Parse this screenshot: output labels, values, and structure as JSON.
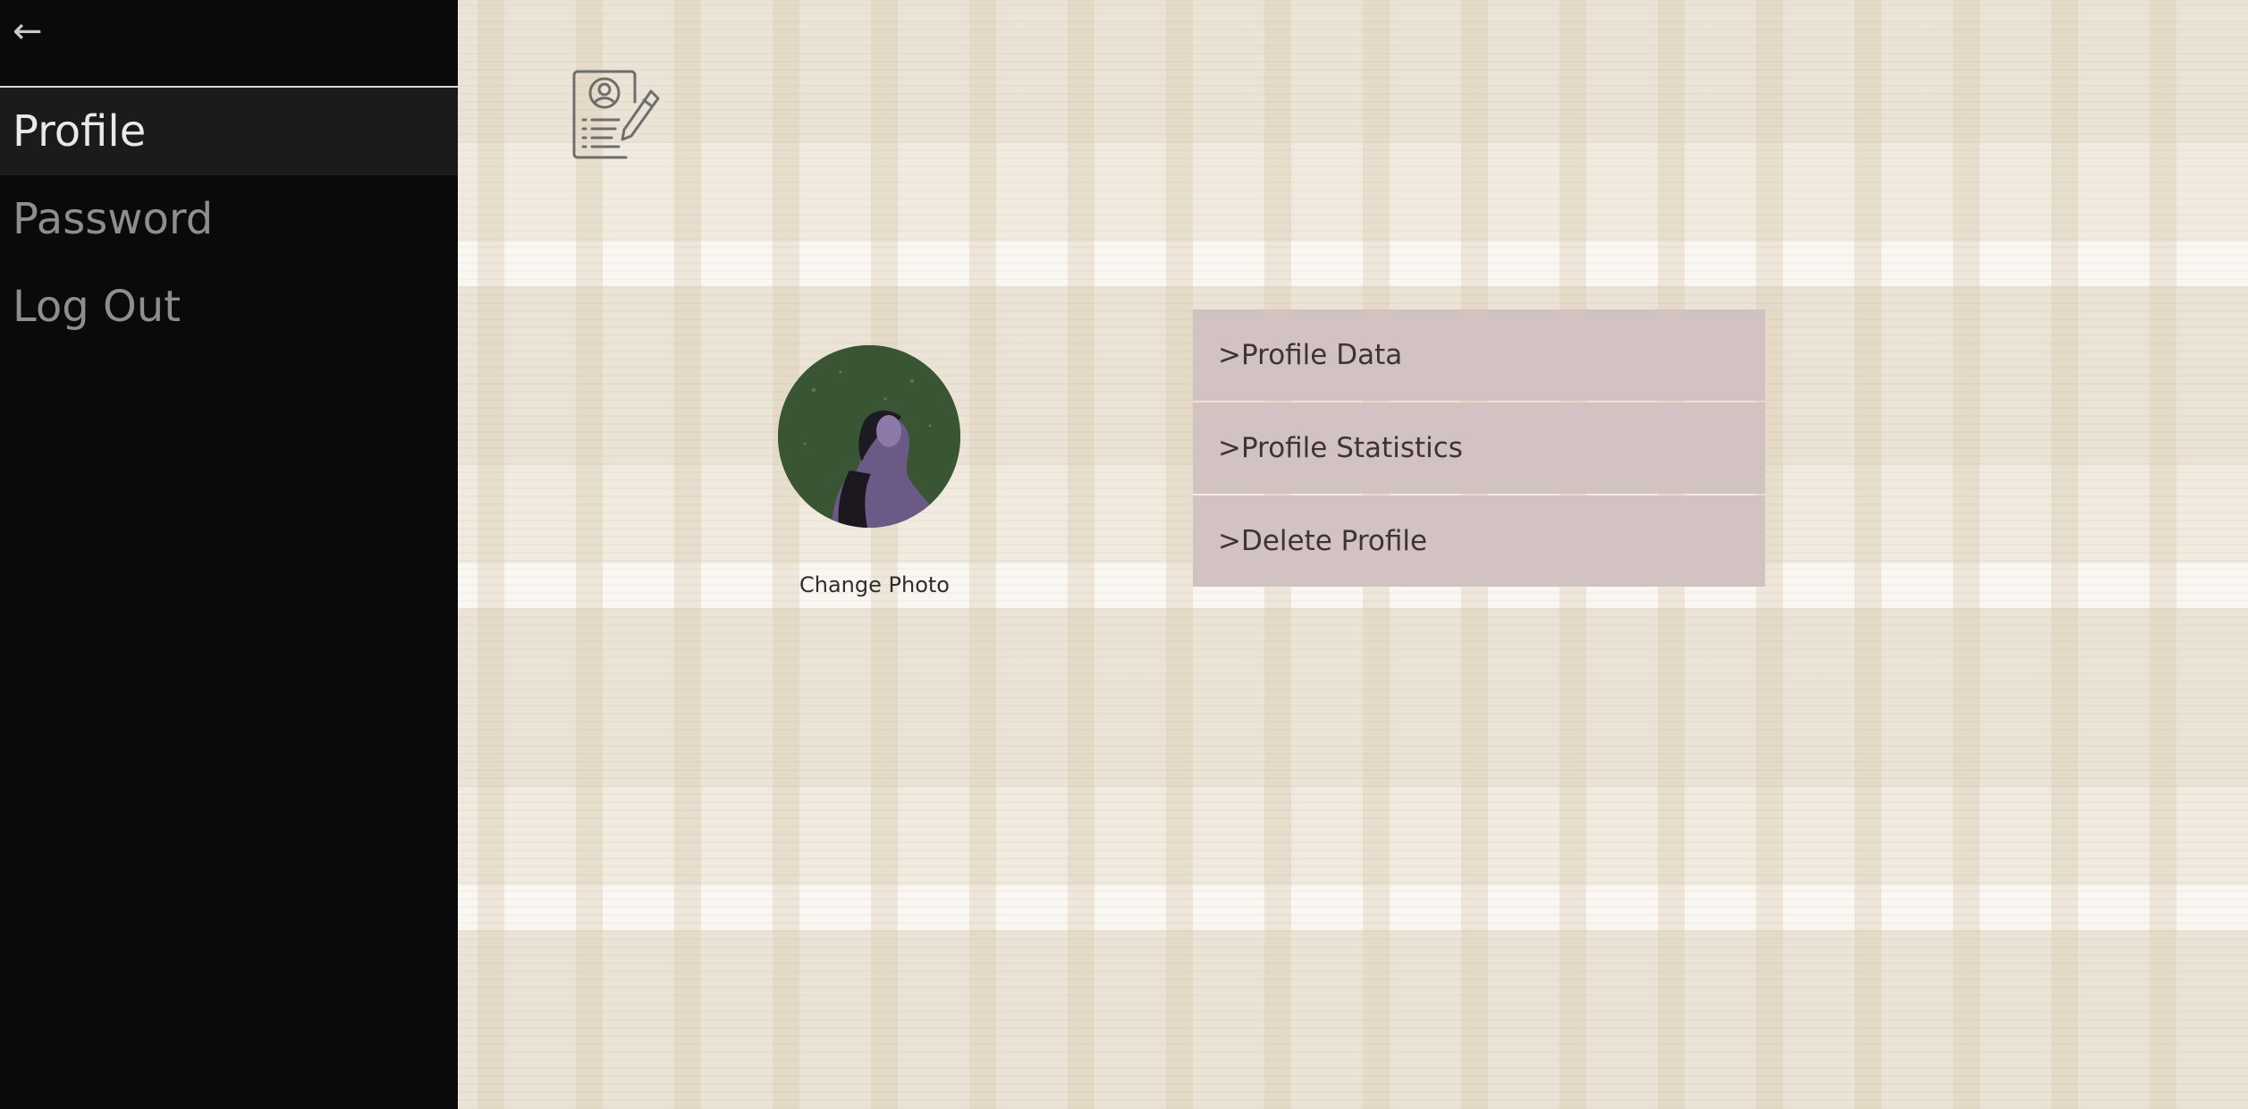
{
  "sidebar": {
    "back_icon": "back-arrow-icon",
    "back_glyph": "←",
    "items": [
      {
        "label": "Profile",
        "active": true
      },
      {
        "label": "Password",
        "active": false
      },
      {
        "label": "Log Out",
        "active": false
      }
    ]
  },
  "main": {
    "header_icon": "profile-document-edit-icon",
    "avatar_label": "Change Photo",
    "menu": [
      {
        "label": ">Profile Data"
      },
      {
        "label": ">Profile Statistics"
      },
      {
        "label": ">Delete Profile"
      }
    ]
  },
  "colors": {
    "sidebar_bg": "#0a0a0a",
    "sidebar_active_bg": "#1b1b1b",
    "menu_button_bg": "#d3c2c2",
    "menu_text": "#3d3535"
  }
}
